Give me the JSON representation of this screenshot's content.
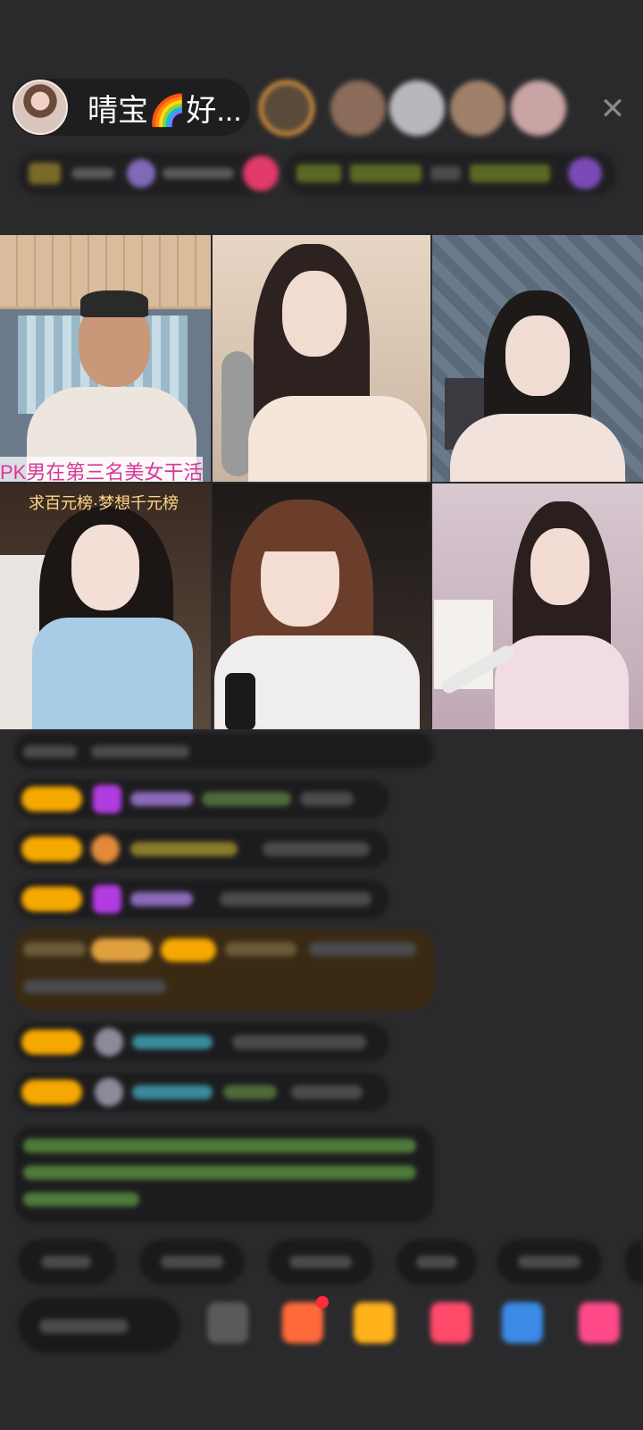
{
  "header": {
    "host_name": "晴宝🌈好...",
    "close_glyph": "✕"
  },
  "video_grid": {
    "tile1_caption": "PK男在第三名美女干活",
    "tile4_caption": "求百元榜·梦想千元榜"
  },
  "colors": {
    "background": "#2a2a2c",
    "caption_pink": "#d8389a",
    "caption_gold": "#ffd98a",
    "badge_gold": "#f5a800",
    "gem_purple": "#b23ce0"
  },
  "icons": [
    "rainbow-emoji",
    "close-icon",
    "gem-icon",
    "gift-icon",
    "emoji-icon",
    "share-icon"
  ]
}
